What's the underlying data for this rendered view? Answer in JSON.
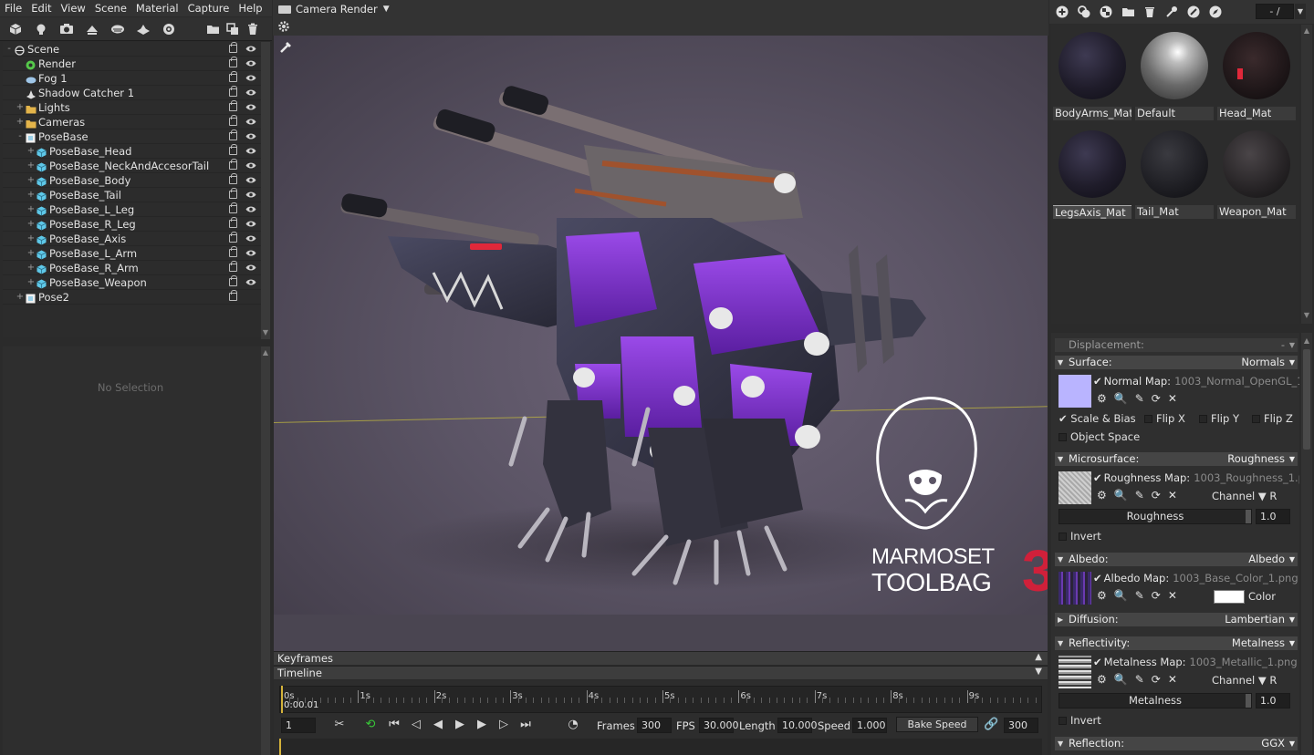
{
  "menu": [
    "File",
    "Edit",
    "View",
    "Scene",
    "Material",
    "Capture",
    "Help"
  ],
  "scene_toolbar_icons": [
    "cube-icon",
    "light-icon",
    "camera-icon",
    "skylight-icon",
    "fog-icon",
    "shadow-catcher-icon",
    "turntable-icon",
    "folder-icon",
    "duplicate-icon",
    "trash-icon"
  ],
  "scene_tree": [
    {
      "label": "Scene",
      "level": 0,
      "icon": "scene-icon",
      "expander": "-",
      "eye": true
    },
    {
      "label": "Render",
      "level": 1,
      "icon": "render-icon",
      "expander": "",
      "eye": true
    },
    {
      "label": "Fog 1",
      "level": 1,
      "icon": "fog-icon",
      "expander": "",
      "eye": true
    },
    {
      "label": "Shadow Catcher 1",
      "level": 1,
      "icon": "shadow-catcher-icon",
      "expander": "",
      "eye": true
    },
    {
      "label": "Lights",
      "level": 1,
      "icon": "folder-icon",
      "expander": "+",
      "eye": true
    },
    {
      "label": "Cameras",
      "level": 1,
      "icon": "folder-icon",
      "expander": "+",
      "eye": true
    },
    {
      "label": "PoseBase",
      "level": 1,
      "icon": "mesh-group-icon",
      "expander": "-",
      "eye": true
    },
    {
      "label": "PoseBase_Head",
      "level": 2,
      "icon": "mesh-icon",
      "expander": "+",
      "eye": true
    },
    {
      "label": "PoseBase_NeckAndAccesorTail",
      "level": 2,
      "icon": "mesh-icon",
      "expander": "+",
      "eye": true
    },
    {
      "label": "PoseBase_Body",
      "level": 2,
      "icon": "mesh-icon",
      "expander": "+",
      "eye": true
    },
    {
      "label": "PoseBase_Tail",
      "level": 2,
      "icon": "mesh-icon",
      "expander": "+",
      "eye": true
    },
    {
      "label": "PoseBase_L_Leg",
      "level": 2,
      "icon": "mesh-icon",
      "expander": "+",
      "eye": true
    },
    {
      "label": "PoseBase_R_Leg",
      "level": 2,
      "icon": "mesh-icon",
      "expander": "+",
      "eye": true
    },
    {
      "label": "PoseBase_Axis",
      "level": 2,
      "icon": "mesh-icon",
      "expander": "+",
      "eye": true
    },
    {
      "label": "PoseBase_L_Arm",
      "level": 2,
      "icon": "mesh-icon",
      "expander": "+",
      "eye": true
    },
    {
      "label": "PoseBase_R_Arm",
      "level": 2,
      "icon": "mesh-icon",
      "expander": "+",
      "eye": true
    },
    {
      "label": "PoseBase_Weapon",
      "level": 2,
      "icon": "mesh-icon",
      "expander": "+",
      "eye": true
    },
    {
      "label": "Pose2",
      "level": 1,
      "icon": "mesh-group-icon",
      "expander": "+",
      "eye": false
    }
  ],
  "left_props": {
    "empty_text": "No Selection"
  },
  "viewport": {
    "camera_label": "Camera Render",
    "logo_line1": "MARMOSET",
    "logo_line2": "TOOLBAG",
    "logo_version": "3"
  },
  "timeline": {
    "keyframes_label": "Keyframes",
    "timeline_label": "Timeline",
    "ticks": [
      "0s",
      "1s",
      "2s",
      "3s",
      "4s",
      "5s",
      "6s",
      "7s",
      "8s",
      "9s"
    ],
    "current_time": "0:00.01",
    "current_frame": "1",
    "frames_label": "Frames",
    "frames_value": "300",
    "fps_label": "FPS",
    "fps_value": "30.000",
    "length_label": "Length",
    "length_value": "10.000",
    "speed_label": "Speed",
    "speed_value": "1.000",
    "bake_label": "Bake Speed",
    "bake_value": "300",
    "playhead_fraction": 0.001
  },
  "mat_toolbar": {
    "icons": [
      "add-material-icon",
      "duplicate-material-icon",
      "checker-icon",
      "folder-icon",
      "trash-icon",
      "picker-icon",
      "select-icon",
      "compass-icon"
    ],
    "search_value": "- /"
  },
  "materials": [
    {
      "name": "BodyArms_Mat",
      "selected": false,
      "ball": "dark-purple"
    },
    {
      "name": "Default",
      "selected": false,
      "ball": "chrome"
    },
    {
      "name": "Head_Mat",
      "selected": false,
      "ball": "dark-red"
    },
    {
      "name": "LegsAxis_Mat",
      "selected": true,
      "ball": "dark-purple"
    },
    {
      "name": "Tail_Mat",
      "selected": false,
      "ball": "dark"
    },
    {
      "name": "Weapon_Mat",
      "selected": false,
      "ball": "dark-grey"
    }
  ],
  "props": {
    "displacement": {
      "title": "Displacement:",
      "value": "-"
    },
    "surface": {
      "title": "Surface:",
      "value": "Normals",
      "map_label": "Normal Map:",
      "map_file": "1003_Normal_OpenGL_1.png",
      "scale_bias": "Scale & Bias",
      "flip_x": "Flip X",
      "flip_y": "Flip Y",
      "flip_z": "Flip Z",
      "object_space": "Object Space",
      "thumb_color": "#b9b4ff"
    },
    "microsurface": {
      "title": "Microsurface:",
      "value": "Roughness",
      "map_label": "Roughness Map:",
      "map_file": "1003_Roughness_1.png",
      "channel": "Channel",
      "channel_value": "R",
      "slider_label": "Roughness",
      "slider_value": "1.0",
      "invert": "Invert"
    },
    "albedo": {
      "title": "Albedo:",
      "value": "Albedo",
      "map_label": "Albedo Map:",
      "map_file": "1003_Base_Color_1.png",
      "color_label": "Color",
      "color_value": "#ffffff"
    },
    "diffusion": {
      "title": "Diffusion:",
      "value": "Lambertian"
    },
    "reflectivity": {
      "title": "Reflectivity:",
      "value": "Metalness",
      "map_label": "Metalness Map:",
      "map_file": "1003_Metallic_1.png",
      "channel": "Channel",
      "channel_value": "R",
      "slider_label": "Metalness",
      "slider_value": "1.0",
      "invert": "Invert"
    },
    "reflection": {
      "title": "Reflection:",
      "value": "GGX"
    }
  },
  "colors": {
    "accent": "#d4b23a",
    "purple": "#8a3ad8",
    "logo_red": "#d0203a"
  }
}
